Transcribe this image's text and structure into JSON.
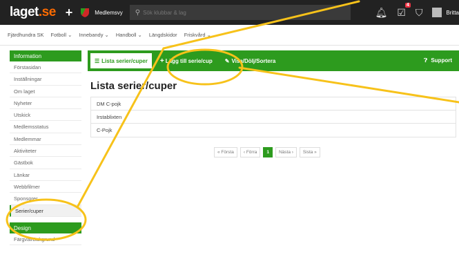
{
  "topbar": {
    "logo_main": "laget",
    "logo_suffix": ".se",
    "member_view": "Medlemsvy",
    "search_placeholder": "Sök klubbar & lag",
    "notification_count": "4",
    "user_name": "Britta"
  },
  "subnav": [
    {
      "label": "Fjärdhundra SK"
    },
    {
      "label": "Fotboll ⌄"
    },
    {
      "label": "Innebandy ⌄"
    },
    {
      "label": "Handboll ⌄"
    },
    {
      "label": "Längdskidor"
    },
    {
      "label": "Friskvård ⌄"
    }
  ],
  "sidebar": {
    "section1_title": "Information",
    "items": [
      {
        "label": "Förstasidan"
      },
      {
        "label": "Inställningar"
      },
      {
        "label": "Om laget"
      },
      {
        "label": "Nyheter"
      },
      {
        "label": "Utskick"
      },
      {
        "label": "Medlemsstatus"
      },
      {
        "label": "Medlemmar"
      },
      {
        "label": "Aktiviteter"
      },
      {
        "label": "Gästbok"
      },
      {
        "label": "Länkar"
      },
      {
        "label": "Webbfilmer"
      },
      {
        "label": "Sponsorer"
      },
      {
        "label": "Serier/cuper"
      }
    ],
    "section2_title": "Design",
    "design_items": [
      {
        "label": "Färgval/Bakgrund"
      }
    ]
  },
  "toolbar": {
    "list_label": "Lista serier/cuper",
    "add_label": "Lägg till serie/cup",
    "sort_label": "Visa/Dölj/Sortera",
    "support_label": "Support"
  },
  "main": {
    "title": "Lista serier/cuper",
    "rows": [
      {
        "label": "DM C-pojk"
      },
      {
        "label": "Irstablixten"
      },
      {
        "label": "C-Pojk"
      }
    ]
  },
  "pager": {
    "first": "« Första",
    "prev": "‹ Förra",
    "current": "1",
    "next": "Nästa ›",
    "last": "Sista »"
  },
  "colors": {
    "accent": "#2d9b1e",
    "highlight": "#f7c21a"
  }
}
